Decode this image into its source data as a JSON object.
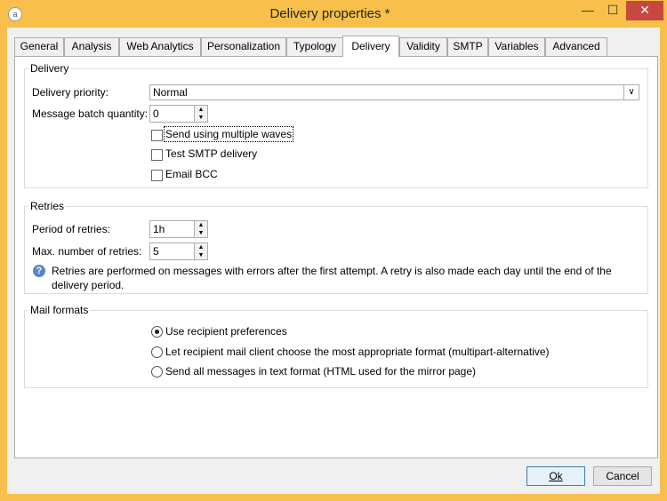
{
  "window": {
    "title": "Delivery properties *",
    "minimize_glyph": "—",
    "maximize_glyph": "☐",
    "close_glyph": "✕",
    "app_icon": "adobe-campaign-icon"
  },
  "tabs": [
    "General",
    "Analysis",
    "Web Analytics",
    "Personalization",
    "Typology",
    "Delivery",
    "Validity",
    "SMTP",
    "Variables",
    "Advanced"
  ],
  "active_tab": "Delivery",
  "delivery": {
    "legend": "Delivery",
    "priority_label": "Delivery priority:",
    "priority_value": "Normal",
    "batch_label": "Message batch quantity:",
    "batch_value": "0",
    "waves_label": "Send using multiple waves",
    "smtp_label": "Test SMTP delivery",
    "bcc_label": "Email BCC"
  },
  "retries": {
    "legend": "Retries",
    "period_label": "Period of retries:",
    "period_value": "1h",
    "max_label": "Max. number of retries:",
    "max_value": "5",
    "note": "Retries are performed on messages with errors after the first attempt. A retry is also made each day until the end of the delivery period."
  },
  "mail_formats": {
    "legend": "Mail formats",
    "options": [
      "Use recipient preferences",
      "Let recipient mail client choose the most appropriate format (multipart-alternative)",
      "Send all messages in text format (HTML used for the mirror page)"
    ]
  },
  "buttons": {
    "ok": "Ok",
    "cancel": "Cancel"
  },
  "colors": {
    "title_bar": "#f7c04a",
    "close": "#c7483e"
  }
}
